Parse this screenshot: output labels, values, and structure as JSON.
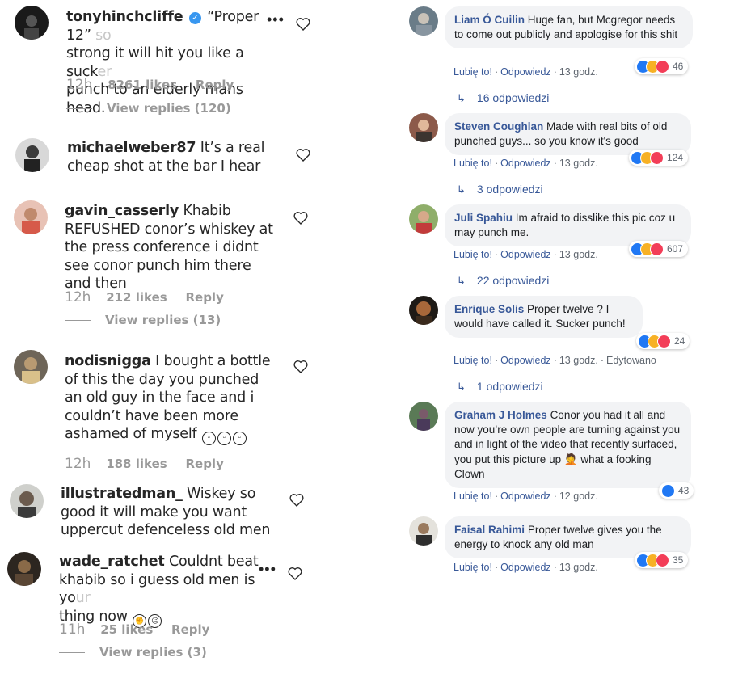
{
  "instagram": {
    "comments": [
      {
        "user": "tonyhinchcliffe",
        "verified": true,
        "text": "“Proper 12”",
        "faded": " so",
        "text2": "strong it will hit you like a suck",
        "faded2": "er",
        "text3": "punch to an elderly mans head.",
        "time": "12h",
        "likes": "8261 likes",
        "reply": "Reply",
        "replies": "View replies (120)"
      },
      {
        "user": "michaelweber87",
        "text": "It’s a real cheap shot at the bar I hear"
      },
      {
        "user": "gavin_casserly",
        "text": "Khabib REFUSHED conor’s whiskey at the press conference i didnt see conor punch him there and then",
        "time": "12h",
        "likes": "212 likes",
        "reply": "Reply",
        "replies": "View replies (13)"
      },
      {
        "user": "nodisnigga",
        "text": "I bought a bottle of this the day you punched an old guy in the face and i couldn’t have been more ashamed of myself",
        "time": "12h",
        "likes": "188 likes",
        "reply": "Reply"
      },
      {
        "user": "illustratedman_",
        "text": "Wiskey so good it will make you want uppercut defenceless old men"
      },
      {
        "user": "wade_ratchet",
        "text": "Couldnt beat khabib so i guess old men is yo",
        "faded": "ur",
        "text2": "thing now",
        "time": "11h",
        "likes": "25 likes",
        "reply": "Reply",
        "replies": "View replies (3)"
      }
    ]
  },
  "facebook": {
    "labels": {
      "like": "Lubię to!",
      "reply": "Odpowiedz",
      "edited": "Edytowano"
    },
    "comments": [
      {
        "name": "Liam Ó Cuilin",
        "text": "Huge fan, but Mcgregor needs to come out publicly and apologise for this shit",
        "reactions": "46",
        "time": "13 godz.",
        "replies": "16 odpowiedzi"
      },
      {
        "name": "Steven Coughlan",
        "text": "Made with real bits of old punched guys... so you know it's good",
        "reactions": "124",
        "time": "13 godz.",
        "replies": "3 odpowiedzi"
      },
      {
        "name": "Juli Spahiu",
        "text": "Im afraid to disslike this pic coz u may punch me.",
        "reactions": "607",
        "time": "13 godz.",
        "replies": "22 odpowiedzi"
      },
      {
        "name": "Enrique Solis",
        "text": "Proper twelve ? I would have called it. Sucker punch!",
        "reactions": "24",
        "time": "13 godz.",
        "replies": "1 odpowiedzi"
      },
      {
        "name": "Graham J Holmes",
        "text": "Conor you had it all and now you’re own people are turning against you and in light of the video that recently surfaced, you put this picture up 🤦 what a fooking Clown",
        "reactions": "43",
        "time": "12 godz."
      },
      {
        "name": "Faisal Rahimi",
        "text": "Proper twelve gives you the energy to knock any old man",
        "reactions": "35",
        "time": "13 godz."
      }
    ]
  },
  "colors": {
    "fb_link": "#385898",
    "fb_bubble": "#f2f3f5",
    "ig_text": "#262626",
    "ig_meta": "#999999"
  }
}
